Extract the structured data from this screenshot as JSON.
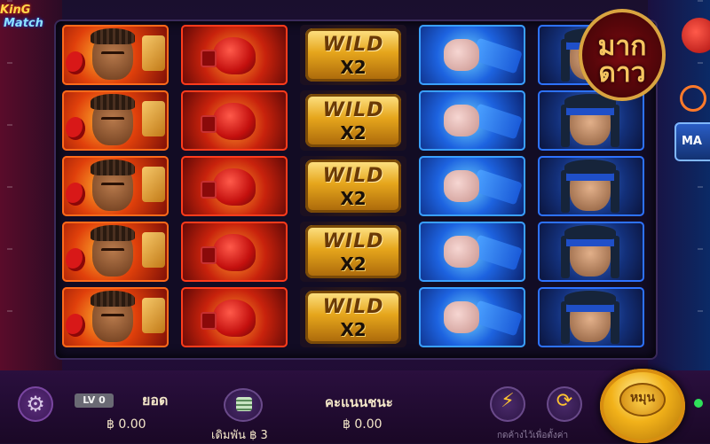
{
  "game": {
    "logo_line1": "KinG",
    "logo_line2": "Match"
  },
  "brand": {
    "line1": "มาก",
    "line2": "ดาว"
  },
  "reels": [
    {
      "symbol": "boxer-dark-red",
      "rows": 5
    },
    {
      "symbol": "red-glove",
      "rows": 5
    },
    {
      "symbol": "wild",
      "rows": 5,
      "wild_text": "WILD",
      "multiplier": "X2"
    },
    {
      "symbol": "blue-fist",
      "rows": 5
    },
    {
      "symbol": "blue-headband-fighter",
      "rows": 5
    }
  ],
  "side": {
    "max_label": "MA"
  },
  "controls": {
    "settings_icon": "⚙",
    "level_badge": "LV 0",
    "balance_label": "ยอด",
    "balance_value": "฿ 0.00",
    "bet_label": "เดิมพัน",
    "bet_value": "฿ 3",
    "win_label": "คะแนนชนะ",
    "win_value": "฿ 0.00",
    "turbo_icon": "⚡",
    "autoplay_icon": "⟳",
    "hint_text": "กดค้างไว้เพื่อตั้งค่า",
    "spin_label": "หมุน"
  }
}
